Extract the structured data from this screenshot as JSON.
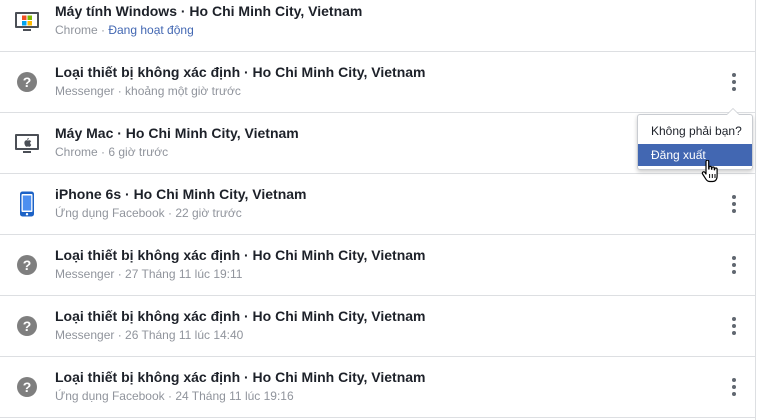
{
  "sessions": [
    {
      "icon": "windows-desktop-icon",
      "title": "Máy tính Windows · Ho Chi Minh City, Vietnam",
      "app": "Chrome · ",
      "time": "",
      "active": "Đang hoạt động",
      "menu": false
    },
    {
      "icon": "unknown-device-icon",
      "title": "Loại thiết bị không xác định · Ho Chi Minh City, Vietnam",
      "app": "Messenger · ",
      "time": "khoảng một giờ trước",
      "menu": true
    },
    {
      "icon": "mac-desktop-icon",
      "title": "Máy Mac · Ho Chi Minh City, Vietnam",
      "app": "Chrome · ",
      "time": "6 giờ trước",
      "menu": false
    },
    {
      "icon": "iphone-icon",
      "title": "iPhone 6s · Ho Chi Minh City, Vietnam",
      "app": "Ứng dụng Facebook · ",
      "time": "22 giờ trước",
      "menu": true
    },
    {
      "icon": "unknown-device-icon",
      "title": "Loại thiết bị không xác định · Ho Chi Minh City, Vietnam",
      "app": "Messenger · ",
      "time": "27 Tháng 11 lúc 19:11",
      "menu": true
    },
    {
      "icon": "unknown-device-icon",
      "title": "Loại thiết bị không xác định · Ho Chi Minh City, Vietnam",
      "app": "Messenger · ",
      "time": "26 Tháng 11 lúc 14:40",
      "menu": true
    },
    {
      "icon": "unknown-device-icon",
      "title": "Loại thiết bị không xác định · Ho Chi Minh City, Vietnam",
      "app": "Ứng dụng Facebook · ",
      "time": "24 Tháng 11 lúc 19:16",
      "menu": true
    }
  ],
  "popup": {
    "not_you": "Không phải bạn?",
    "log_out": "Đăng xuất"
  },
  "colors": {
    "link_blue": "#4267b2",
    "muted": "#90949c",
    "text": "#1d2129"
  }
}
